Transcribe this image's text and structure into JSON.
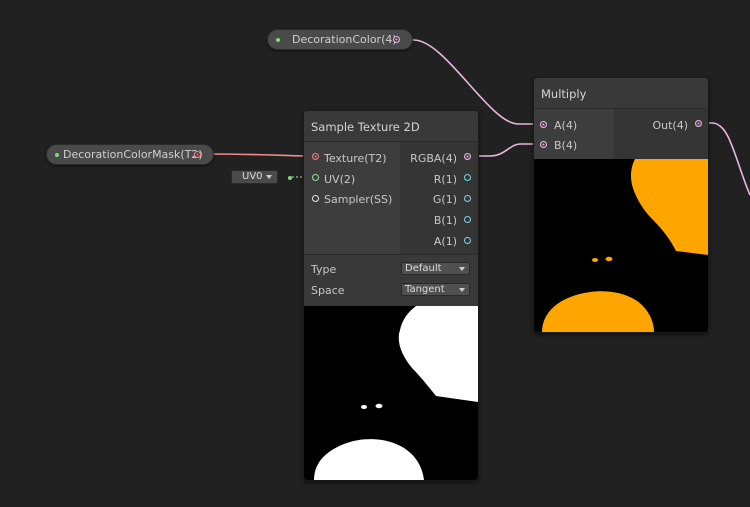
{
  "decoration_color": {
    "label": "DecorationColor(4)"
  },
  "decoration_color_mask": {
    "label": "DecorationColorMask(T2)"
  },
  "uv_dropdown": {
    "value": "UV0"
  },
  "sample_texture": {
    "title": "Sample Texture 2D",
    "inputs": [
      "Texture(T2)",
      "UV(2)",
      "Sampler(SS)"
    ],
    "outputs": [
      "RGBA(4)",
      "R(1)",
      "G(1)",
      "B(1)",
      "A(1)"
    ],
    "type_label": "Type",
    "type_value": "Default",
    "space_label": "Space",
    "space_value": "Tangent"
  },
  "multiply": {
    "title": "Multiply",
    "inputs": [
      "A(4)",
      "B(4)"
    ],
    "output": "Out(4)",
    "preview_color": "#ffa500"
  },
  "colors": {
    "background": "#212121",
    "node": "#393939",
    "wire_color": "#e8b8de",
    "wire_texture": "#f08a8a",
    "wire_uv": "#7ed07e"
  }
}
